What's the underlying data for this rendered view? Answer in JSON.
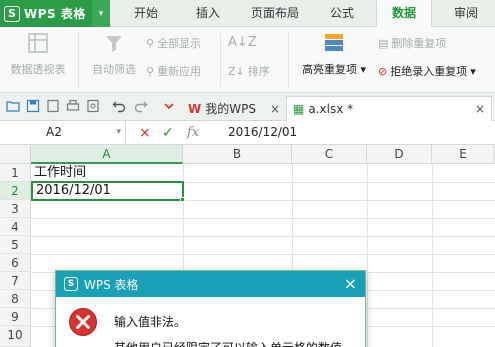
{
  "app": {
    "title": "WPS 表格",
    "logo_letter": "S"
  },
  "menu": {
    "tabs": [
      {
        "label": "开始"
      },
      {
        "label": "插入"
      },
      {
        "label": "页面布局"
      },
      {
        "label": "公式"
      },
      {
        "label": "数据",
        "active": true
      },
      {
        "label": "审阅"
      }
    ]
  },
  "ribbon": {
    "pivot_table": "数据透视表",
    "auto_filter": "自动筛选",
    "show_all": "全部显示",
    "reapply": "重新应用",
    "sort": "排序",
    "highlight_dup": "高亮重复项",
    "remove_dup": "删除重复项",
    "reject_dup": "拒绝录入重复项"
  },
  "doc_tabs": [
    {
      "label": "我的WPS",
      "close": "×"
    },
    {
      "label": "a.xlsx *",
      "close": "×",
      "active": true
    }
  ],
  "formula_bar": {
    "cell_ref": "A2",
    "cancel_symbol": "×",
    "confirm_symbol": "✓",
    "fx_symbol": "fx",
    "value": "2016/12/01"
  },
  "grid": {
    "columns": [
      "A",
      "B",
      "C",
      "D",
      "E"
    ],
    "rows": [
      "1",
      "2",
      "3",
      "4",
      "5",
      "6",
      "7",
      "8",
      "9",
      "10"
    ],
    "cells": {
      "A1": "工作时间",
      "A2": "2016/12/01"
    },
    "selected": "A2"
  },
  "dialog": {
    "title": "WPS 表格",
    "close": "×",
    "message": "输入值非法。",
    "detail": "其他用户已经限定了可以输入单元格的数值。"
  },
  "colors": {
    "brand_green": "#2b9b45",
    "dialog_title": "#18a0b6",
    "selection": "#2e8f3f",
    "error_red": "#d9322f"
  }
}
